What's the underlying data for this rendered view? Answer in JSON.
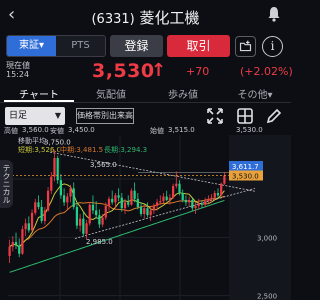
{
  "header": {
    "back_icon": "chevron-left-icon",
    "code": "(6331)",
    "name": "菱化工機",
    "bell_icon": "bell-icon"
  },
  "actions": {
    "market_primary": "東証",
    "market_caret": "▾",
    "market_pts": "PTS",
    "buy": "登録",
    "sell": "取引",
    "fav_icon": "folder-icon",
    "info_icon": "info-icon",
    "info_glyph": "i"
  },
  "quote": {
    "label": "現在値",
    "time": "15:24",
    "price": "3,530",
    "arrow": "↑",
    "change": "+70",
    "change_pct": "(+2.02%)"
  },
  "tabs": [
    {
      "label": "チャート"
    },
    {
      "label": "気配値"
    },
    {
      "label": "歩み値"
    },
    {
      "label": "その他"
    }
  ],
  "tabs_more_caret": "▾",
  "toolbar": {
    "period": "日足",
    "period_caret": "▼",
    "tag_button": "価格帯別出来高",
    "icons": [
      "expand-icon",
      "grid-icon",
      "pencil-icon"
    ]
  },
  "ohlc": {
    "open_lbl": "高値",
    "open": "3,560.0",
    "v2_lbl": "安値",
    "v2": "3,450.0",
    "v3_lbl": "始値",
    "v3": "3,515.0",
    "v4": "3,530.0"
  },
  "side_tab": "テクニカル",
  "ma_legend": {
    "title": "移動平均",
    "short": "短期:3,526.0",
    "mid": "中期:3,481.5",
    "long": "長期:3,294.3"
  },
  "colors": {
    "up": "#ef3b46",
    "down": "#1fd28a",
    "accent": "#2f6ed8",
    "ma_short": "#c8c83a",
    "ma_mid": "#d9772a",
    "ma_long": "#2fb86e"
  },
  "chart_data": {
    "type": "candlestick",
    "annotations": [
      {
        "label": "3,750.0"
      },
      {
        "label": "3,565.0"
      },
      {
        "label": "2,985.0"
      }
    ],
    "y_ticks": [
      {
        "label": "3,611.7"
      },
      {
        "label": "3,530.0"
      },
      {
        "label": "3,000"
      },
      {
        "label": "2,500"
      }
    ],
    "candles": [
      [
        2840,
        2980,
        2780,
        2920
      ],
      [
        2920,
        3010,
        2880,
        2960
      ],
      [
        2960,
        3040,
        2900,
        2930
      ],
      [
        2930,
        2990,
        2830,
        2860
      ],
      [
        2860,
        3100,
        2850,
        3070
      ],
      [
        3070,
        3160,
        3010,
        3120
      ],
      [
        3120,
        3180,
        3040,
        3060
      ],
      [
        3060,
        3240,
        3050,
        3210
      ],
      [
        3210,
        3330,
        3190,
        3300
      ],
      [
        3300,
        3360,
        3240,
        3260
      ],
      [
        3260,
        3320,
        3120,
        3140
      ],
      [
        3140,
        3260,
        3110,
        3230
      ],
      [
        3230,
        3430,
        3220,
        3400
      ],
      [
        3400,
        3560,
        3370,
        3520
      ],
      [
        3520,
        3750,
        3480,
        3680
      ],
      [
        3680,
        3700,
        3460,
        3490
      ],
      [
        3490,
        3540,
        3330,
        3360
      ],
      [
        3360,
        3420,
        3270,
        3300
      ],
      [
        3300,
        3380,
        3240,
        3350
      ],
      [
        3350,
        3450,
        3300,
        3420
      ],
      [
        3420,
        3470,
        3240,
        3260
      ],
      [
        3260,
        3300,
        3070,
        3100
      ],
      [
        3100,
        3200,
        3050,
        3160
      ],
      [
        3160,
        3220,
        3010,
        3030
      ],
      [
        3030,
        3150,
        2985,
        3120
      ],
      [
        3120,
        3300,
        3100,
        3280
      ],
      [
        3280,
        3360,
        3200,
        3230
      ],
      [
        3230,
        3310,
        3160,
        3190
      ],
      [
        3190,
        3240,
        3080,
        3110
      ],
      [
        3110,
        3200,
        3090,
        3170
      ],
      [
        3170,
        3300,
        3150,
        3270
      ],
      [
        3270,
        3350,
        3230,
        3330
      ],
      [
        3330,
        3400,
        3280,
        3300
      ],
      [
        3300,
        3380,
        3250,
        3360
      ],
      [
        3360,
        3420,
        3310,
        3340
      ],
      [
        3340,
        3380,
        3220,
        3250
      ],
      [
        3250,
        3330,
        3200,
        3300
      ],
      [
        3300,
        3360,
        3260,
        3280
      ],
      [
        3280,
        3420,
        3270,
        3400
      ],
      [
        3400,
        3470,
        3300,
        3330
      ],
      [
        3330,
        3380,
        3240,
        3260
      ],
      [
        3260,
        3300,
        3180,
        3200
      ],
      [
        3200,
        3280,
        3160,
        3250
      ],
      [
        3250,
        3300,
        3170,
        3190
      ],
      [
        3190,
        3260,
        3140,
        3230
      ],
      [
        3230,
        3290,
        3200,
        3270
      ],
      [
        3270,
        3330,
        3230,
        3300
      ],
      [
        3300,
        3360,
        3280,
        3310
      ],
      [
        3310,
        3380,
        3290,
        3350
      ],
      [
        3350,
        3400,
        3310,
        3320
      ],
      [
        3320,
        3370,
        3280,
        3340
      ],
      [
        3340,
        3460,
        3330,
        3440
      ],
      [
        3440,
        3565,
        3420,
        3460
      ],
      [
        3460,
        3490,
        3360,
        3380
      ],
      [
        3380,
        3410,
        3300,
        3320
      ],
      [
        3320,
        3360,
        3270,
        3300
      ],
      [
        3300,
        3350,
        3260,
        3320
      ],
      [
        3320,
        3340,
        3230,
        3250
      ],
      [
        3250,
        3300,
        3200,
        3270
      ],
      [
        3270,
        3330,
        3240,
        3290
      ],
      [
        3290,
        3320,
        3250,
        3280
      ],
      [
        3280,
        3340,
        3260,
        3310
      ],
      [
        3310,
        3360,
        3290,
        3330
      ],
      [
        3330,
        3370,
        3300,
        3340
      ],
      [
        3340,
        3400,
        3320,
        3380
      ],
      [
        3380,
        3420,
        3330,
        3360
      ],
      [
        3360,
        3470,
        3350,
        3460
      ],
      [
        3460,
        3560,
        3450,
        3530
      ]
    ]
  }
}
